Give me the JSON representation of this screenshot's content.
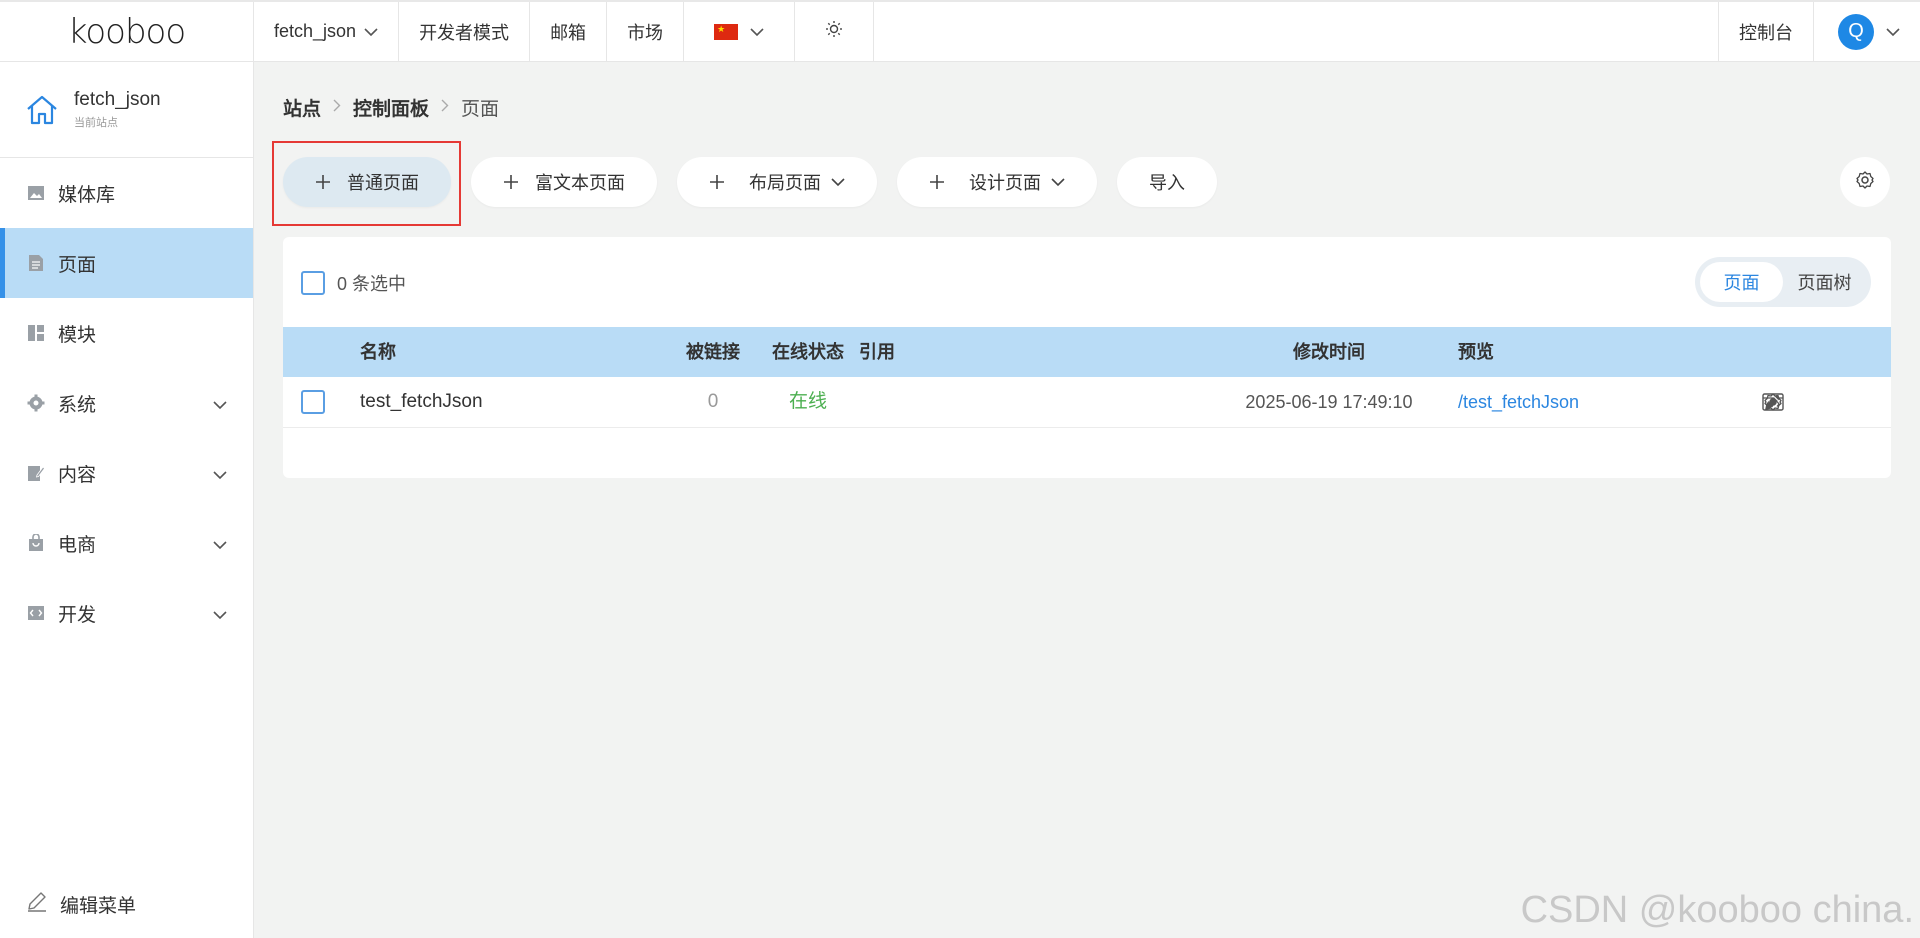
{
  "brand": {
    "logo_text": "kooboo"
  },
  "topbar": {
    "site_selector": "fetch_json",
    "developer_mode": "开发者模式",
    "mail": "邮箱",
    "market": "市场",
    "language_icon": "china-flag-icon",
    "theme_icon": "sun-icon",
    "console": "控制台",
    "avatar_letter": "Q"
  },
  "sidebar": {
    "site_name": "fetch_json",
    "site_sub": "当前站点",
    "items": [
      {
        "label": "媒体库",
        "icon": "image-icon",
        "active": false,
        "expandable": false
      },
      {
        "label": "页面",
        "icon": "page-icon",
        "active": true,
        "expandable": false
      },
      {
        "label": "模块",
        "icon": "module-icon",
        "active": false,
        "expandable": false
      },
      {
        "label": "系统",
        "icon": "gear-icon",
        "active": false,
        "expandable": true
      },
      {
        "label": "内容",
        "icon": "content-icon",
        "active": false,
        "expandable": true
      },
      {
        "label": "电商",
        "icon": "shop-icon",
        "active": false,
        "expandable": true
      },
      {
        "label": "开发",
        "icon": "code-icon",
        "active": false,
        "expandable": true
      }
    ],
    "edit_menu": "编辑菜单"
  },
  "breadcrumb": {
    "site": "站点",
    "dashboard": "控制面板",
    "current": "页面"
  },
  "toolbar": {
    "normal_page": "普通页面",
    "rich_text_page": "富文本页面",
    "layout_page": "布局页面",
    "design_page": "设计页面",
    "import": "导入"
  },
  "selection": {
    "text": "0 条选中"
  },
  "view_toggle": {
    "page": "页面",
    "page_tree": "页面树",
    "active": "页面"
  },
  "table": {
    "headers": {
      "name": "名称",
      "linked": "被链接",
      "status": "在线状态",
      "ref": "引用",
      "modified": "修改时间",
      "preview": "预览"
    },
    "rows": [
      {
        "name": "test_fetchJson",
        "linked": "0",
        "status": "在线",
        "ref": "",
        "modified": "2025-06-19 17:49:10",
        "preview": "/test_fetchJson"
      }
    ]
  },
  "watermark": "CSDN @kooboo china.",
  "colors": {
    "accent": "#2b86e0",
    "active_bg": "#b9dcf6",
    "online": "#4caf50",
    "highlight": "#e53935"
  }
}
